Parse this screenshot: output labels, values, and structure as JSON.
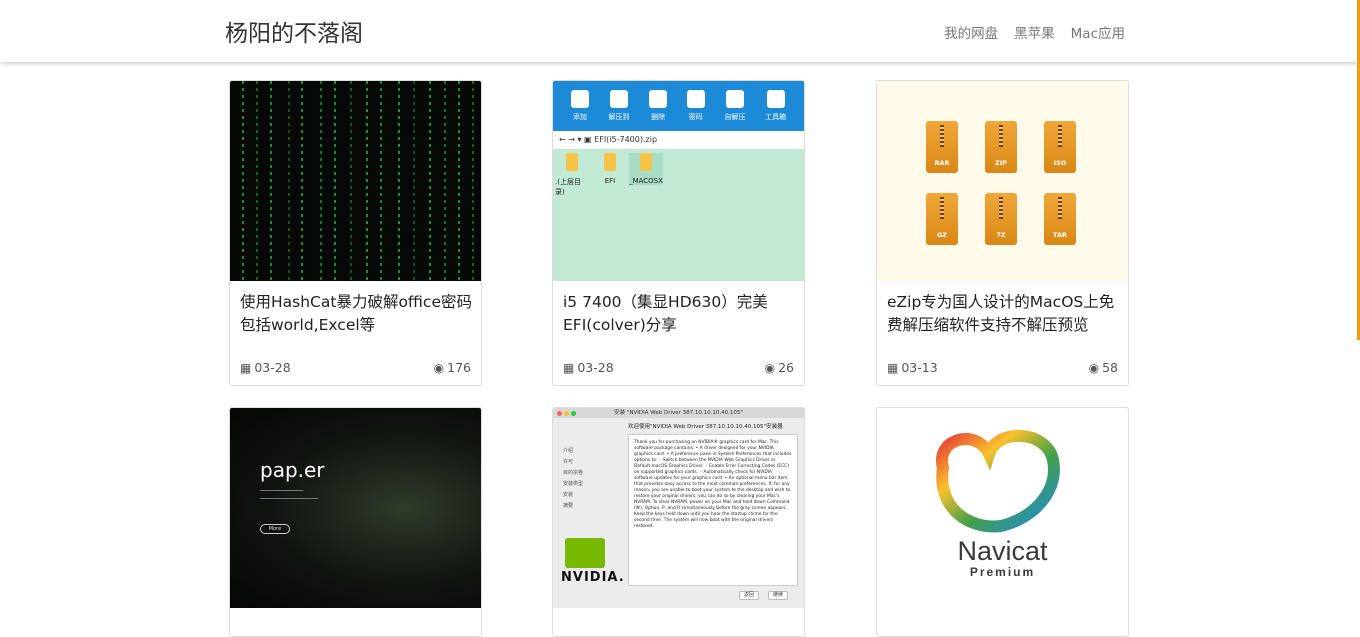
{
  "site": {
    "brand": "杨阳的不落阁"
  },
  "nav": [
    "我的网盘",
    "黑苹果",
    "Mac应用"
  ],
  "cards": [
    {
      "title": "使用HashCat暴力破解office密码包括world,Excel等",
      "date": "03-28",
      "views": "176"
    },
    {
      "title": "i5 7400（集显HD630）完美EFI(colver)分享",
      "date": "03-28",
      "views": "26"
    },
    {
      "title": "eZip专为国人设计的MacOS上免费解压缩软件支持不解压预览",
      "date": "03-13",
      "views": "58"
    },
    {
      "title": "",
      "date": "",
      "views": ""
    },
    {
      "title": "",
      "date": "",
      "views": ""
    },
    {
      "title": "",
      "date": "",
      "views": ""
    }
  ],
  "thumb_zip": {
    "tools": [
      "添加",
      "解压到",
      "删除",
      "密码",
      "自解压",
      "工具箱"
    ],
    "path": "EFI(i5-7400).zip",
    "folders": [
      ".(上层目录)",
      "EFI",
      "_MACOSX"
    ]
  },
  "thumb_archives": [
    "RAR",
    "ZIP",
    "ISO",
    "GZ",
    "7Z",
    "TAR"
  ],
  "thumb_paper": {
    "logo": "pap.er",
    "button": "More"
  },
  "thumb_nvidia": {
    "window_title": "安装 \"NVIDIA Web Driver 387.10.10.10.40.105\"",
    "heading": "欢迎使用\"NVIDIA Web Driver 387.10.10.10.40.105\"安装器",
    "steps": [
      "介绍",
      "许可",
      "目的宗卷",
      "安装类型",
      "安装",
      "摘要"
    ],
    "body": "Thank you for purchasing an NVIDIA® graphics card for Mac. This software package contains: • A driver designed for your NVIDIA graphics card. • A preference pane in System Preferences that includes options to: ◦ Switch between the NVIDIA Web Graphics Driver or Default macOS Graphics Driver. ◦ Enable Error Correcting Codes (ECC) on supported graphics cards. ◦ Automatically check for NVIDIA software updates for your graphics card. • An optional menu bar item that provides easy access to the most common preferences. If, for any reason, you are unable to boot your system to the desktop and wish to restore your original drivers, you can do so by clearing your Mac's NVRAM. To clear NVRAM, power on your Mac and hold down Command (⌘), Option, P, and R simultaneously before the gray screen appears. Keep the keys held down until you hear the startup chime for the second time. The system will now boot with the original drivers restored.",
    "logo_text": "NVIDIA.",
    "back_button": "返回",
    "continue_button": "继续"
  },
  "thumb_navicat": {
    "name": "Navicat",
    "edition": "Premium"
  }
}
